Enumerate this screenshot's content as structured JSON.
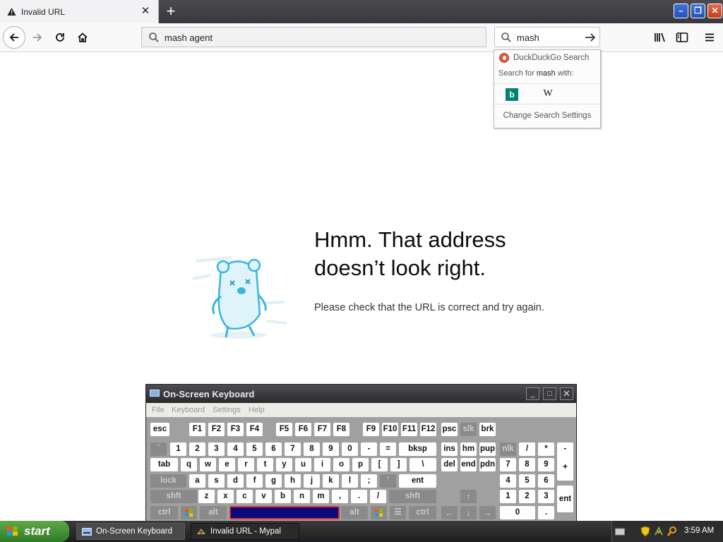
{
  "tab": {
    "title": "Invalid URL",
    "close": "✕",
    "new_tab": "+"
  },
  "window_controls": {
    "minimize": "–",
    "maximize": "❐",
    "close": "✕"
  },
  "urlbar": {
    "value": "mash agent"
  },
  "searchbar": {
    "value": "mash"
  },
  "search_dropdown": {
    "engine": "DuckDuckGo Search",
    "search_for_prefix": "Search for",
    "search_term": "mash",
    "search_for_suffix": "with:",
    "engines": [
      {
        "name": "Bing",
        "glyph": "b"
      },
      {
        "name": "Wikipedia",
        "glyph": "W"
      }
    ],
    "settings_label": "Change Search Settings"
  },
  "error": {
    "title_line1": "Hmm. That address",
    "title_line2": "doesn’t look right.",
    "description": "Please check that the URL is correct and try again."
  },
  "osk": {
    "title": "On-Screen Keyboard",
    "menu": [
      "File",
      "Keyboard",
      "Settings",
      "Help"
    ],
    "keys": [
      {
        "name": "esc",
        "label": "esc"
      },
      {
        "name": "f1",
        "label": "F1"
      },
      {
        "name": "f2",
        "label": "F2"
      },
      {
        "name": "f3",
        "label": "F3"
      },
      {
        "name": "f4",
        "label": "F4"
      },
      {
        "name": "f5",
        "label": "F5"
      },
      {
        "name": "f6",
        "label": "F6"
      },
      {
        "name": "f7",
        "label": "F7"
      },
      {
        "name": "f8",
        "label": "F8"
      },
      {
        "name": "f9",
        "label": "F9"
      },
      {
        "name": "f10",
        "label": "F10"
      },
      {
        "name": "f11",
        "label": "F11"
      },
      {
        "name": "f12",
        "label": "F12"
      },
      {
        "name": "psc",
        "label": "psc"
      },
      {
        "name": "slk",
        "label": "slk"
      },
      {
        "name": "brk",
        "label": "brk"
      },
      {
        "name": "backtick",
        "label": "`"
      },
      {
        "name": "1",
        "label": "1"
      },
      {
        "name": "2",
        "label": "2"
      },
      {
        "name": "3",
        "label": "3"
      },
      {
        "name": "4",
        "label": "4"
      },
      {
        "name": "5",
        "label": "5"
      },
      {
        "name": "6",
        "label": "6"
      },
      {
        "name": "7",
        "label": "7"
      },
      {
        "name": "8",
        "label": "8"
      },
      {
        "name": "9",
        "label": "9"
      },
      {
        "name": "0",
        "label": "0"
      },
      {
        "name": "minus",
        "label": "-"
      },
      {
        "name": "equals",
        "label": "="
      },
      {
        "name": "bksp",
        "label": "bksp"
      },
      {
        "name": "ins",
        "label": "ins"
      },
      {
        "name": "hm",
        "label": "hm"
      },
      {
        "name": "pup",
        "label": "pup"
      },
      {
        "name": "nlk",
        "label": "nlk"
      },
      {
        "name": "num-slash",
        "label": "/"
      },
      {
        "name": "num-star",
        "label": "*"
      },
      {
        "name": "num-minus",
        "label": "-"
      },
      {
        "name": "tab",
        "label": "tab"
      },
      {
        "name": "q",
        "label": "q"
      },
      {
        "name": "w",
        "label": "w"
      },
      {
        "name": "e",
        "label": "e"
      },
      {
        "name": "r",
        "label": "r"
      },
      {
        "name": "t",
        "label": "t"
      },
      {
        "name": "y",
        "label": "y"
      },
      {
        "name": "u",
        "label": "u"
      },
      {
        "name": "i",
        "label": "i"
      },
      {
        "name": "o",
        "label": "o"
      },
      {
        "name": "p",
        "label": "p"
      },
      {
        "name": "lbracket",
        "label": "["
      },
      {
        "name": "rbracket",
        "label": "]"
      },
      {
        "name": "backslash",
        "label": "\\"
      },
      {
        "name": "del",
        "label": "del"
      },
      {
        "name": "end",
        "label": "end"
      },
      {
        "name": "pdn",
        "label": "pdn"
      },
      {
        "name": "num7",
        "label": "7"
      },
      {
        "name": "num8",
        "label": "8"
      },
      {
        "name": "num9",
        "label": "9"
      },
      {
        "name": "num-plus",
        "label": "+"
      },
      {
        "name": "lock",
        "label": "lock"
      },
      {
        "name": "a",
        "label": "a"
      },
      {
        "name": "s",
        "label": "s"
      },
      {
        "name": "d",
        "label": "d"
      },
      {
        "name": "f",
        "label": "f"
      },
      {
        "name": "g",
        "label": "g"
      },
      {
        "name": "h",
        "label": "h"
      },
      {
        "name": "j",
        "label": "j"
      },
      {
        "name": "k",
        "label": "k"
      },
      {
        "name": "l",
        "label": "l"
      },
      {
        "name": "semicolon",
        "label": ";"
      },
      {
        "name": "quote",
        "label": "'"
      },
      {
        "name": "ent",
        "label": "ent"
      },
      {
        "name": "num4",
        "label": "4"
      },
      {
        "name": "num5",
        "label": "5"
      },
      {
        "name": "num6",
        "label": "6"
      },
      {
        "name": "lshft",
        "label": "shft"
      },
      {
        "name": "z",
        "label": "z"
      },
      {
        "name": "x",
        "label": "x"
      },
      {
        "name": "c",
        "label": "c"
      },
      {
        "name": "v",
        "label": "v"
      },
      {
        "name": "b",
        "label": "b"
      },
      {
        "name": "n",
        "label": "n"
      },
      {
        "name": "m",
        "label": "m"
      },
      {
        "name": "comma",
        "label": ","
      },
      {
        "name": "period",
        "label": "."
      },
      {
        "name": "slash",
        "label": "/"
      },
      {
        "name": "rshft",
        "label": "shft"
      },
      {
        "name": "up",
        "label": "↑"
      },
      {
        "name": "num1",
        "label": "1"
      },
      {
        "name": "num2",
        "label": "2"
      },
      {
        "name": "num3",
        "label": "3"
      },
      {
        "name": "num-ent",
        "label": "ent"
      },
      {
        "name": "lctrl",
        "label": "ctrl"
      },
      {
        "name": "lwin",
        "label": ""
      },
      {
        "name": "lalt",
        "label": "alt"
      },
      {
        "name": "space",
        "label": ""
      },
      {
        "name": "ralt",
        "label": "alt"
      },
      {
        "name": "rwin",
        "label": ""
      },
      {
        "name": "menu",
        "label": "☰"
      },
      {
        "name": "rctrl",
        "label": "ctrl"
      },
      {
        "name": "left",
        "label": "←"
      },
      {
        "name": "down",
        "label": "↓"
      },
      {
        "name": "right",
        "label": "→"
      },
      {
        "name": "num0",
        "label": "0"
      },
      {
        "name": "num-dot",
        "label": "."
      }
    ]
  },
  "taskbar": {
    "start_label": "start",
    "buttons": [
      {
        "label": "On-Screen Keyboard"
      },
      {
        "label": "Invalid URL - Mypal"
      }
    ],
    "clock": "3:59 AM"
  },
  "colors": {
    "accent": "#0a84ff",
    "osk_selected": "#0a0a7a",
    "start_green": "#3c8d2f"
  }
}
